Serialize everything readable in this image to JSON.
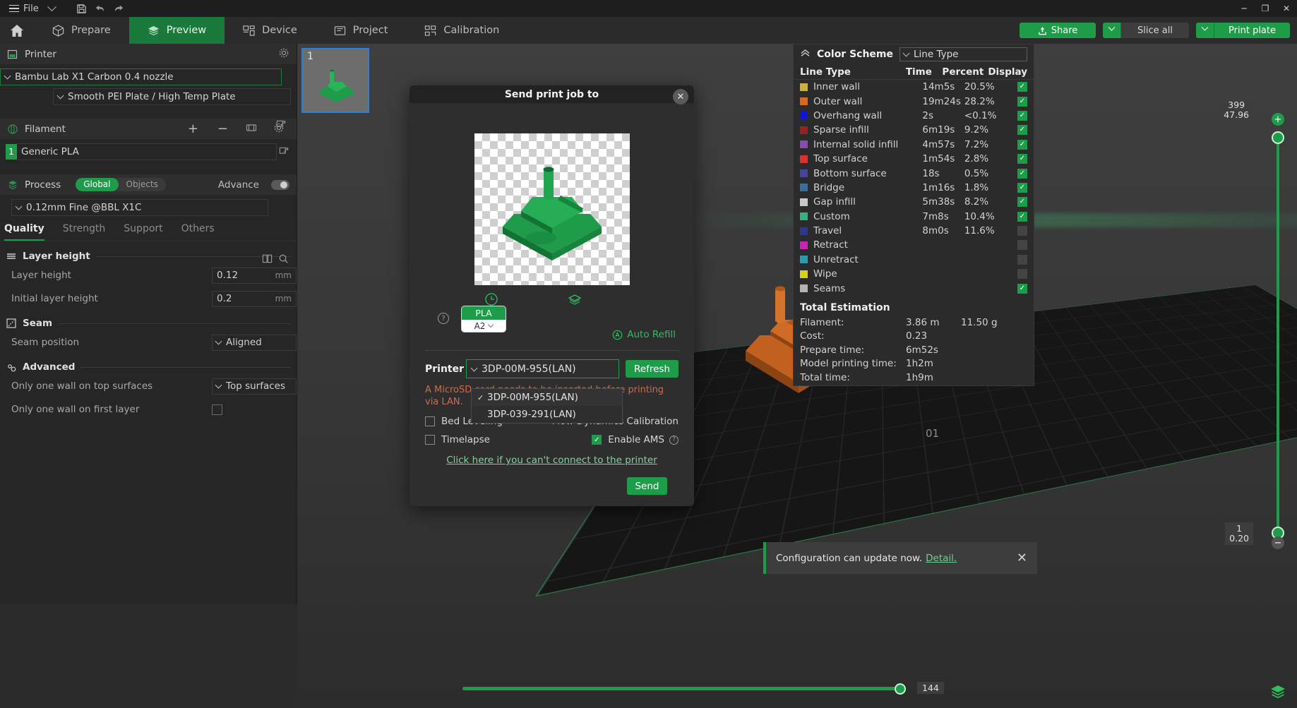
{
  "titlebar": {
    "file_menu": "File",
    "icons": [
      "hamburger-icon",
      "chevron-down-icon",
      "save-icon",
      "undo-icon",
      "redo-icon"
    ],
    "window": {
      "minimize": "─",
      "maximize": "❐",
      "close": "✕"
    }
  },
  "mainnav": {
    "home_icon": "home-icon",
    "tabs": [
      {
        "label": "Prepare",
        "icon": "cube-icon",
        "active": false
      },
      {
        "label": "Preview",
        "icon": "layers-icon",
        "active": true
      },
      {
        "label": "Device",
        "icon": "device-icon",
        "active": false
      },
      {
        "label": "Project",
        "icon": "folder-icon",
        "active": false
      },
      {
        "label": "Calibration",
        "icon": "calibration-icon",
        "active": false
      }
    ],
    "share": "Share",
    "slice_all": "Slice all",
    "print_plate": "Print plate"
  },
  "left_panel": {
    "printer": {
      "section": "Printer",
      "gear_icon": "gear-icon",
      "model": "Bambu Lab X1 Carbon 0.4 nozzle",
      "plate": "Smooth PEI Plate / High Temp Plate"
    },
    "filament": {
      "section": "Filament",
      "add": "+",
      "remove": "−",
      "index": "1",
      "name": "Generic PLA"
    },
    "process": {
      "section": "Process",
      "global": "Global",
      "objects": "Objects",
      "advance": "Advance",
      "preset": "0.12mm Fine @BBL X1C"
    },
    "tabs": [
      "Quality",
      "Strength",
      "Support",
      "Others"
    ],
    "active_tab": "Quality",
    "groups": [
      {
        "title": "Layer height",
        "rows": [
          {
            "label": "Layer height",
            "value": "0.12",
            "unit": "mm",
            "kind": "text"
          },
          {
            "label": "Initial layer height",
            "value": "0.2",
            "unit": "mm",
            "kind": "text"
          }
        ]
      },
      {
        "title": "Seam",
        "rows": [
          {
            "label": "Seam position",
            "value": "Aligned",
            "unit": "",
            "kind": "select"
          }
        ]
      },
      {
        "title": "Advanced",
        "rows": [
          {
            "label": "Only one wall on top surfaces",
            "value": "Top surfaces",
            "unit": "",
            "kind": "select"
          },
          {
            "label": "Only one wall on first layer",
            "value": "",
            "unit": "",
            "kind": "checkbox"
          }
        ]
      }
    ]
  },
  "plate_thumb": {
    "number": "1"
  },
  "color_scheme": {
    "title": "Color Scheme",
    "collapse_icon": "chevron-up-icon",
    "mode": "Line Type",
    "columns": [
      "Line Type",
      "Time",
      "Percent",
      "Display"
    ],
    "rows": [
      {
        "name": "Inner wall",
        "time": "14m5s",
        "percent": "20.5%",
        "color": "#c9b437",
        "display": true
      },
      {
        "name": "Outer wall",
        "time": "19m24s",
        "percent": "28.2%",
        "color": "#e0661e",
        "display": true
      },
      {
        "name": "Overhang wall",
        "time": "2s",
        "percent": "<0.1%",
        "color": "#1212d8",
        "display": true
      },
      {
        "name": "Sparse infill",
        "time": "6m19s",
        "percent": "9.2%",
        "color": "#9c2020",
        "display": true
      },
      {
        "name": "Internal solid infill",
        "time": "4m57s",
        "percent": "7.2%",
        "color": "#8a49b5",
        "display": true
      },
      {
        "name": "Top surface",
        "time": "1m54s",
        "percent": "2.8%",
        "color": "#e02d2d",
        "display": true
      },
      {
        "name": "Bottom surface",
        "time": "18s",
        "percent": "0.5%",
        "color": "#45459c",
        "display": true
      },
      {
        "name": "Bridge",
        "time": "1m16s",
        "percent": "1.8%",
        "color": "#3a6e9c",
        "display": true
      },
      {
        "name": "Gap infill",
        "time": "5m38s",
        "percent": "8.2%",
        "color": "#c8c8c8",
        "display": true
      },
      {
        "name": "Custom",
        "time": "7m8s",
        "percent": "10.4%",
        "color": "#35b37e",
        "display": true
      },
      {
        "name": "Travel",
        "time": "8m0s",
        "percent": "11.6%",
        "color": "#2a3a8c",
        "display": false
      },
      {
        "name": "Retract",
        "time": "",
        "percent": "",
        "color": "#cc22b8",
        "display": false
      },
      {
        "name": "Unretract",
        "time": "",
        "percent": "",
        "color": "#2a9bb5",
        "display": false
      },
      {
        "name": "Wipe",
        "time": "",
        "percent": "",
        "color": "#d4d415",
        "display": false
      },
      {
        "name": "Seams",
        "time": "",
        "percent": "",
        "color": "#b4b4b4",
        "display": true
      }
    ],
    "total_title": "Total Estimation",
    "totals": [
      {
        "key": "Filament:",
        "v1": "3.86 m",
        "v2": "11.50 g"
      },
      {
        "key": "Cost:",
        "v1": "0.23",
        "v2": ""
      },
      {
        "key": "Prepare time:",
        "v1": "6m52s",
        "v2": ""
      },
      {
        "key": "Model printing time:",
        "v1": "1h2m",
        "v2": ""
      },
      {
        "key": "Total time:",
        "v1": "1h9m",
        "v2": ""
      }
    ]
  },
  "sliders": {
    "vertical": {
      "top_label_1": "399",
      "top_label_2": "47.96",
      "bottom_label_1": "1",
      "bottom_label_2": "0.20",
      "plus": "+",
      "minus": "−"
    },
    "horizontal": {
      "value": "144"
    }
  },
  "toast": {
    "message": "Configuration can update now.",
    "link": "Detail.",
    "close": "✕"
  },
  "modal": {
    "title": "Send print job to",
    "close": "✕",
    "edit_icon": "pencil-icon",
    "clock_icon": "clock-icon",
    "layers_icon": "layers-icon",
    "help_icon": "help-icon",
    "ams": {
      "material": "PLA",
      "slot": "A2"
    },
    "auto_refill": "Auto Refill",
    "printer_label": "Printer",
    "printer_value": "3DP-00M-955(LAN)",
    "refresh": "Refresh",
    "warning_pre": "A MicroSD",
    "warning_mid": "card needs to be inserted before printing via LAN.",
    "options": [
      {
        "label": "Bed Leveling",
        "checked": false
      },
      {
        "label": "Flow Dynamics Calibration",
        "checked": false
      },
      {
        "label": "Timelapse",
        "checked": false
      },
      {
        "label": "Enable AMS",
        "checked": true,
        "help": true
      }
    ],
    "cant_connect": "Click here if you can't connect to the printer",
    "send": "Send",
    "dropdown": {
      "open": true,
      "items": [
        {
          "label": "3DP-00M-955(LAN)",
          "selected": true
        },
        {
          "label": "3DP-039-291(LAN)",
          "selected": false
        }
      ]
    }
  },
  "viewport": {
    "axis_label": "01",
    "layers_button_icon": "layers-icon"
  }
}
